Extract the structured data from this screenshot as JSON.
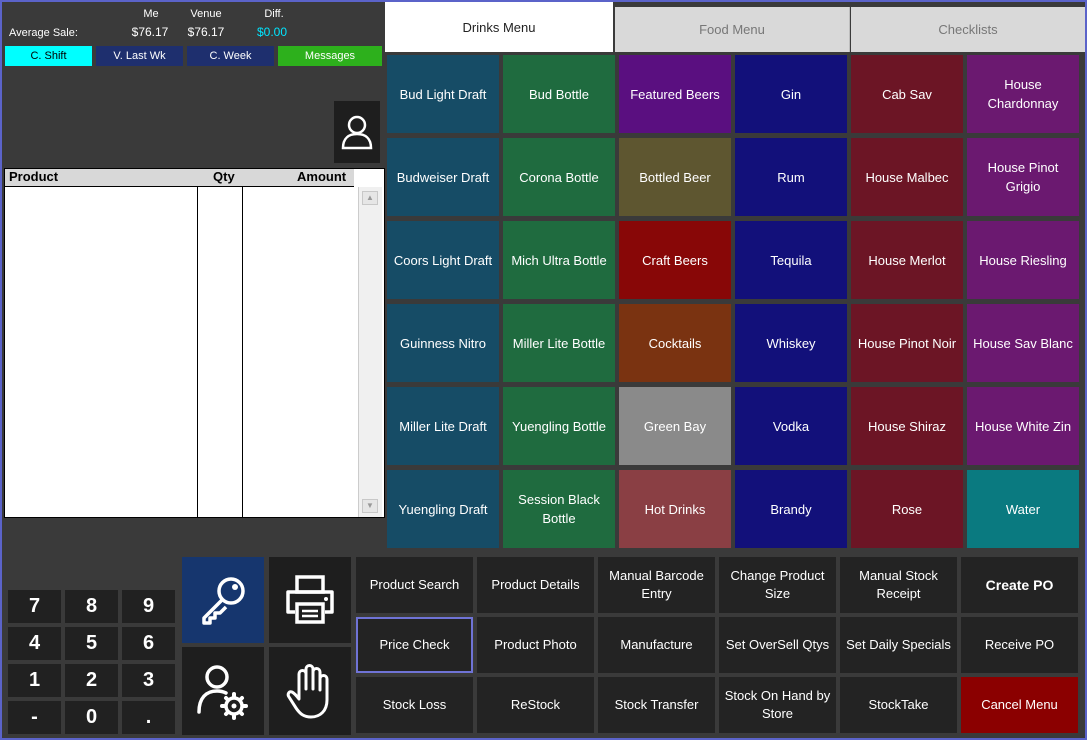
{
  "summary": {
    "label": "Average Sale:",
    "headers": [
      "Me",
      "Venue",
      "Diff."
    ],
    "values": [
      "$76.17",
      "$76.17",
      "$0.00"
    ]
  },
  "periods": [
    {
      "label": "C. Shift",
      "color": "#00ffff",
      "text_color": "#000000"
    },
    {
      "label": "V. Last Wk",
      "color": "#1e2f6e",
      "text_color": "#ffffff"
    },
    {
      "label": "C. Week",
      "color": "#1e2f6e",
      "text_color": "#ffffff"
    },
    {
      "label": "Messages",
      "color": "#2db01c",
      "text_color": "#ffffff"
    }
  ],
  "order": {
    "columns": [
      "Product",
      "Qty",
      "Amount"
    ]
  },
  "tabs": [
    "Drinks Menu",
    "Food Menu",
    "Checklists"
  ],
  "menu_tiles": [
    [
      {
        "label": "Bud Light Draft",
        "color": "#164c66"
      },
      {
        "label": "Bud Bottle",
        "color": "#1f6b3f"
      },
      {
        "label": "Featured Beers",
        "color": "#5a0f80"
      },
      {
        "label": "Gin",
        "color": "#12107a"
      },
      {
        "label": "Cab Sav",
        "color": "#6c1525"
      },
      {
        "label": "House Chardonnay",
        "color": "#6b1970"
      }
    ],
    [
      {
        "label": "Budweiser Draft",
        "color": "#164c66"
      },
      {
        "label": "Corona Bottle",
        "color": "#1f6b3f"
      },
      {
        "label": "Bottled Beer",
        "color": "#5e5630"
      },
      {
        "label": "Rum",
        "color": "#12107a"
      },
      {
        "label": "House Malbec",
        "color": "#6c1525"
      },
      {
        "label": "House Pinot Grigio",
        "color": "#6b1970"
      }
    ],
    [
      {
        "label": "Coors Light Draft",
        "color": "#164c66"
      },
      {
        "label": "Mich Ultra Bottle",
        "color": "#1f6b3f"
      },
      {
        "label": "Craft Beers",
        "color": "#880707"
      },
      {
        "label": "Tequila",
        "color": "#12107a"
      },
      {
        "label": "House Merlot",
        "color": "#6c1525"
      },
      {
        "label": "House Riesling",
        "color": "#6b1970"
      }
    ],
    [
      {
        "label": "Guinness Nitro",
        "color": "#164c66"
      },
      {
        "label": "Miller Lite Bottle",
        "color": "#1f6b3f"
      },
      {
        "label": "Cocktails",
        "color": "#7a3311"
      },
      {
        "label": "Whiskey",
        "color": "#12107a"
      },
      {
        "label": "House Pinot Noir",
        "color": "#6c1525"
      },
      {
        "label": "House Sav Blanc",
        "color": "#6b1970"
      }
    ],
    [
      {
        "label": "Miller Lite Draft",
        "color": "#164c66"
      },
      {
        "label": "Yuengling Bottle",
        "color": "#1f6b3f"
      },
      {
        "label": "Green Bay",
        "color": "#8a8a8a"
      },
      {
        "label": "Vodka",
        "color": "#12107a"
      },
      {
        "label": "House Shiraz",
        "color": "#6c1525"
      },
      {
        "label": "House White Zin",
        "color": "#6b1970"
      }
    ],
    [
      {
        "label": "Yuengling Draft",
        "color": "#164c66"
      },
      {
        "label": "Session Black Bottle",
        "color": "#1f6b3f"
      },
      {
        "label": "Hot Drinks",
        "color": "#8a3f44"
      },
      {
        "label": "Brandy",
        "color": "#12107a"
      },
      {
        "label": "Rose",
        "color": "#6c1525"
      },
      {
        "label": "Water",
        "color": "#0a7a80"
      }
    ]
  ],
  "keypad": [
    "7",
    "8",
    "9",
    "4",
    "5",
    "6",
    "1",
    "2",
    "3",
    "-",
    "0",
    "."
  ],
  "icons": [
    "key-icon",
    "printer-icon",
    "user-settings-icon",
    "hand-icon",
    "user-icon"
  ],
  "functions": [
    [
      "Product Search",
      "Product Details",
      "Manual Barcode Entry",
      "Change Product Size",
      "Manual Stock Receipt",
      "Create PO"
    ],
    [
      "Price Check",
      "Product Photo",
      "Manufacture",
      "Set OverSell Qtys",
      "Set Daily Specials",
      "Receive PO"
    ],
    [
      "Stock Loss",
      "ReStock",
      "Stock Transfer",
      "Stock On Hand by Store",
      "StockTake",
      "Cancel Menu"
    ]
  ],
  "colors": {
    "background": "#3a3a3a",
    "frame": "#5b63c9",
    "selected_outline": "#6f73d6",
    "cancel": "#8b0000",
    "accent_blue": "#1e2f6e",
    "diff_value": "#00e5ff"
  }
}
